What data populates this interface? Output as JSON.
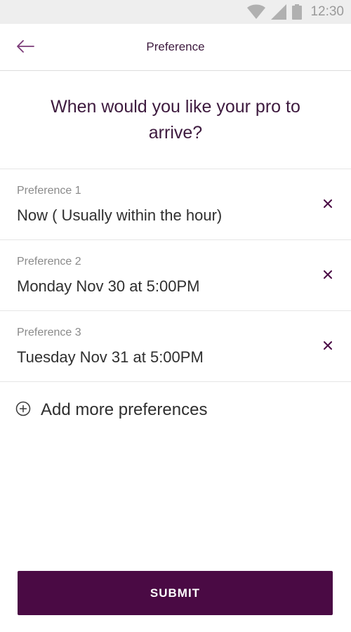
{
  "status_bar": {
    "time": "12:30",
    "icons": [
      "wifi-icon",
      "cell-signal-icon",
      "battery-icon"
    ]
  },
  "app_bar": {
    "title": "Preference",
    "back_icon": "back-arrow-icon"
  },
  "question": "When would you like your pro to arrive?",
  "preferences": [
    {
      "label": "Preference 1",
      "value": "Now ( Usually within the hour)"
    },
    {
      "label": "Preference 2",
      "value": "Monday Nov 30 at 5:00PM"
    },
    {
      "label": "Preference 3",
      "value": "Tuesday Nov 31 at 5:00PM"
    }
  ],
  "add_more": {
    "label": "Add more preferences",
    "icon": "plus-circle-icon"
  },
  "submit": {
    "label": "SUBMIT"
  },
  "colors": {
    "brand": "#4a0a44",
    "heading": "#3d1a3e",
    "accent_icon": "#7b3a78",
    "status_bar_bg": "#eeeeee"
  }
}
